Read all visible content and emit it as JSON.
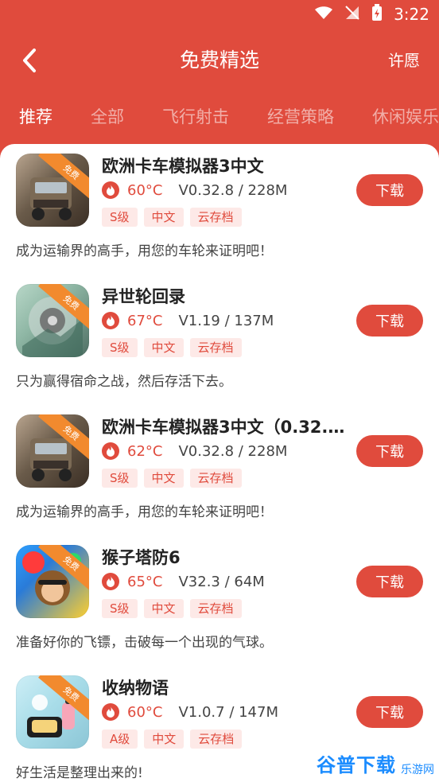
{
  "status": {
    "time": "3:22"
  },
  "header": {
    "title": "免费精选",
    "right_action": "许愿"
  },
  "tabs": [
    {
      "label": "推荐",
      "active": true
    },
    {
      "label": "全部",
      "active": false
    },
    {
      "label": "飞行射击",
      "active": false
    },
    {
      "label": "经营策略",
      "active": false
    },
    {
      "label": "休闲娱乐",
      "active": false
    }
  ],
  "games": [
    {
      "name": "欧洲卡车模拟器3中文",
      "heat": "60°C",
      "version_size": "V0.32.8 / 228M",
      "tags": [
        "S级",
        "中文",
        "云存档"
      ],
      "badge": "免费",
      "download_label": "下载",
      "desc": "成为运输界的高手，用您的车轮来证明吧！"
    },
    {
      "name": "异世轮回录",
      "heat": "67°C",
      "version_size": "V1.19 / 137M",
      "tags": [
        "S级",
        "中文",
        "云存档"
      ],
      "badge": "免费",
      "download_label": "下载",
      "desc": "只为赢得宿命之战，然后存活下去。"
    },
    {
      "name": "欧洲卡车模拟器3中文（0.32.8...",
      "heat": "62°C",
      "version_size": "V0.32.8 / 228M",
      "tags": [
        "S级",
        "中文",
        "云存档"
      ],
      "badge": "免费",
      "download_label": "下载",
      "desc": "成为运输界的高手，用您的车轮来证明吧！"
    },
    {
      "name": "猴子塔防6",
      "heat": "65°C",
      "version_size": "V32.3 / 64M",
      "tags": [
        "S级",
        "中文",
        "云存档"
      ],
      "badge": "免费",
      "download_label": "下载",
      "desc": "准备好你的飞镖，击破每一个出现的气球。"
    },
    {
      "name": "收纳物语",
      "heat": "60°C",
      "version_size": "V1.0.7 / 147M",
      "tags": [
        "A级",
        "中文",
        "云存档"
      ],
      "badge": "免费",
      "download_label": "下载",
      "desc": "好生活是整理出来的!"
    }
  ],
  "watermark": {
    "text": "谷普下载",
    "sub": "乐游网"
  },
  "colors": {
    "accent": "#e04b3d",
    "tag_bg": "#fde9e7",
    "ribbon": "#f28a2e"
  },
  "icons": {
    "back": "chevron-left-icon",
    "wifi": "wifi-icon",
    "signal": "signal-icon",
    "battery": "battery-icon",
    "heat": "flame-icon"
  }
}
